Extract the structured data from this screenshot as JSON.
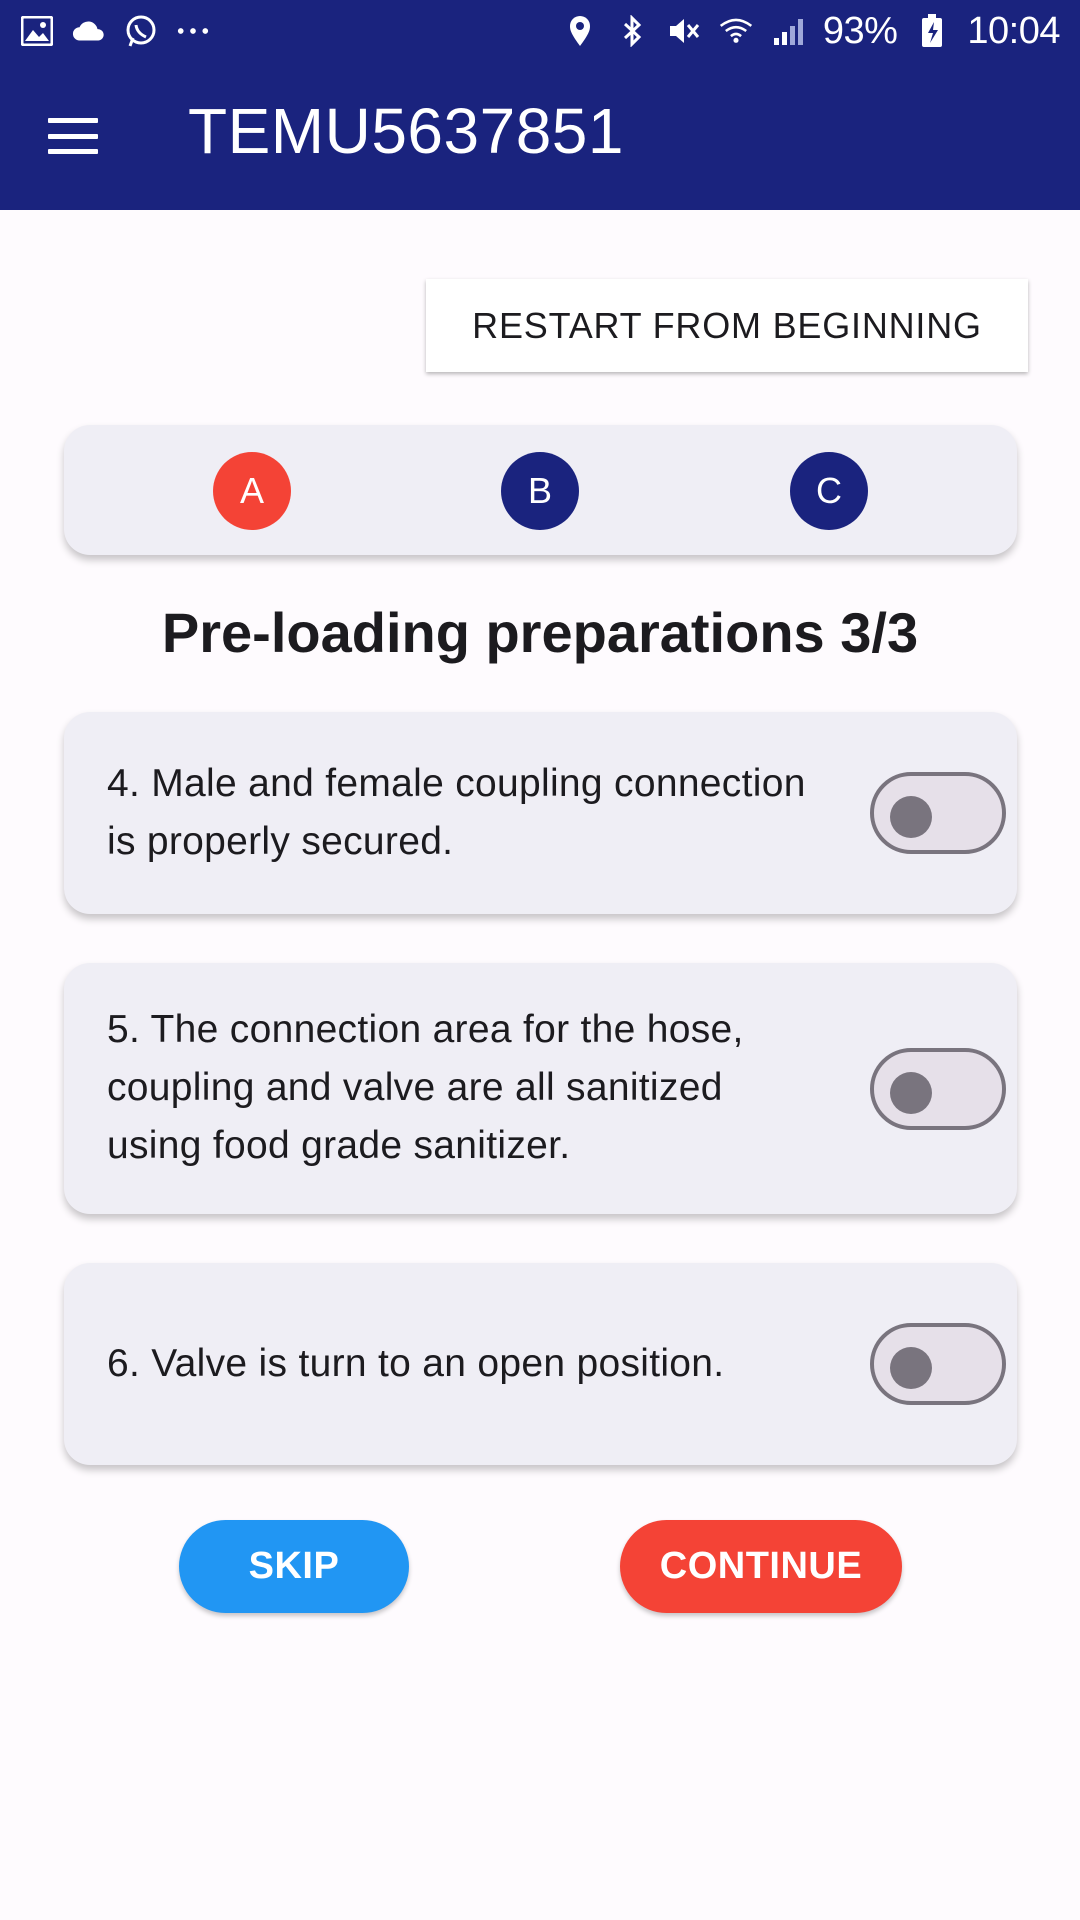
{
  "status_bar": {
    "left_icons": [
      "image-icon",
      "cloud-icon",
      "whatsapp-icon",
      "more-dots-icon"
    ],
    "right_icons": [
      "location-icon",
      "bluetooth-icon",
      "mute-icon",
      "wifi-icon",
      "signal-icon",
      "battery-charging-icon"
    ],
    "battery": "93%",
    "time": "10:04"
  },
  "app_bar": {
    "title": "TEMU5637851",
    "menu_icon": "hamburger-menu-icon"
  },
  "restart_button": "RESTART FROM BEGINNING",
  "stepper": {
    "steps": [
      {
        "label": "A",
        "color": "#f44336"
      },
      {
        "label": "B",
        "color": "#1a237e"
      },
      {
        "label": "C",
        "color": "#1a237e"
      }
    ]
  },
  "section_title": "Pre-loading preparations 3/3",
  "checklist": [
    {
      "text": "4. Male and female coupling connection is properly secured.",
      "checked": false
    },
    {
      "text": "5. The connection area for the hose, coupling and valve are all sanitized using food grade sanitizer.",
      "checked": false
    },
    {
      "text": "6. Valve is turn to an open position.",
      "checked": false
    }
  ],
  "actions": {
    "skip": "SKIP",
    "continue": "CONTINUE"
  },
  "colors": {
    "primary": "#1a237e",
    "accent_red": "#f44336",
    "accent_blue": "#2196f3"
  }
}
